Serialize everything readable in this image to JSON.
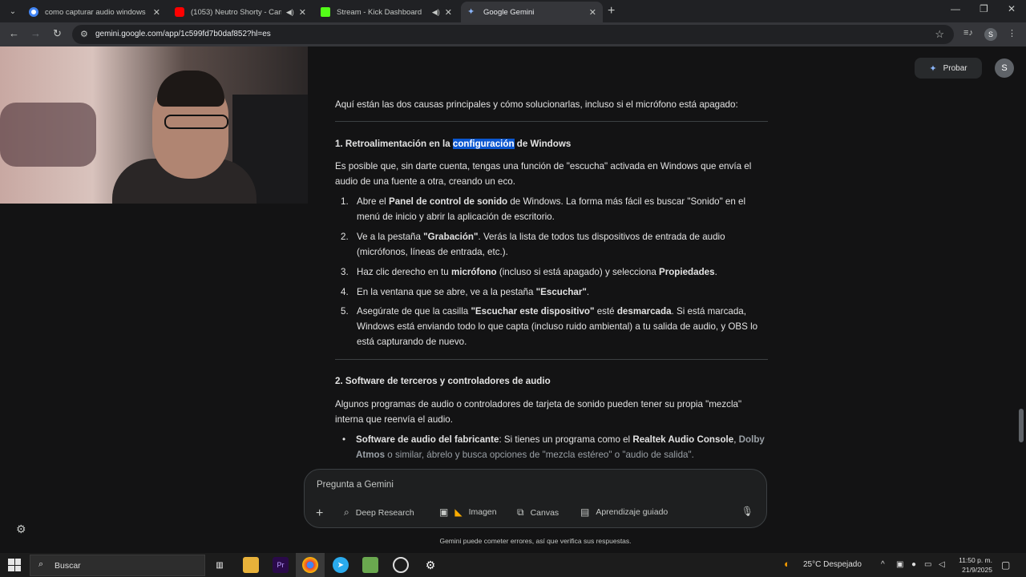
{
  "browser": {
    "tabs": [
      {
        "title": "como capturar audio windows",
        "favicon_color": "#4285f4",
        "active": false
      },
      {
        "title": "(1053) Neutro Shorty - Cam",
        "favicon_color": "#ff0000",
        "active": false
      },
      {
        "title": "Stream - Kick Dashboard",
        "favicon_color": "#53fc18",
        "active": false
      },
      {
        "title": "Google Gemini",
        "favicon_color": "#8ab4f8",
        "active": true
      }
    ],
    "url": "gemini.google.com/app/1c599fd7b0daf852?hl=es",
    "profile_initial": "S"
  },
  "gemini": {
    "probar_label": "Probar",
    "avatar_initial": "S",
    "intro": "Aquí están las dos causas principales y cómo solucionarlas, incluso si el micrófono está apagado:",
    "section1": {
      "heading_pre": "1. Retroalimentación en la ",
      "heading_highlight": "configuración",
      "heading_post": " de Windows",
      "intro": "Es posible que, sin darte cuenta, tengas una función de \"escucha\" activada en Windows que envía el audio de una fuente a otra, creando un eco.",
      "steps": [
        {
          "num": "1.",
          "a": "Abre el ",
          "b": "Panel de control de sonido",
          "c": " de Windows. La forma más fácil es buscar \"Sonido\" en el menú de inicio y abrir la aplicación de escritorio."
        },
        {
          "num": "2.",
          "a": "Ve a la pestaña ",
          "b": "\"Grabación\"",
          "c": ". Verás la lista de todos tus dispositivos de entrada de audio (micrófonos, líneas de entrada, etc.)."
        },
        {
          "num": "3.",
          "a": "Haz clic derecho en tu ",
          "b": "micrófono",
          "c": " (incluso si está apagado) y selecciona ",
          "d": "Propiedades",
          "e": "."
        },
        {
          "num": "4.",
          "a": "En la ventana que se abre, ve a la pestaña ",
          "b": "\"Escuchar\"",
          "c": "."
        },
        {
          "num": "5.",
          "a": "Asegúrate de que la casilla ",
          "b": "\"Escuchar este dispositivo\"",
          "c": " esté ",
          "d": "desmarcada",
          "e": ". Si está marcada, Windows está enviando todo lo que capta (incluso ruido ambiental) a tu salida de audio, y OBS lo está capturando de nuevo."
        }
      ]
    },
    "section2": {
      "heading": "2. Software de terceros y controladores de audio",
      "intro": "Algunos programas de audio o controladores de tarjeta de sonido pueden tener su propia \"mezcla\" interna que reenvía el audio.",
      "bullet": {
        "a": "Software de audio del fabricante",
        "b": ": Si tienes un programa como el ",
        "c": "Realtek Audio Console",
        "d": ",",
        "e": "Dolby Atmos",
        "f": " o similar, ábrelo y busca opciones de \"mezcla estéreo\" o \"audio de salida\"."
      }
    },
    "prompt": {
      "placeholder": "Pregunta a Gemini",
      "tools": [
        "Deep Research",
        "Imagen",
        "Canvas",
        "Aprendizaje guiado"
      ]
    },
    "disclaimer": "Gemini puede cometer errores, así que verifica sus respuestas."
  },
  "taskbar": {
    "search_label": "Buscar",
    "weather": "25°C  Despejado",
    "time": "11:50 p. m.",
    "date": "21/9/2025"
  }
}
